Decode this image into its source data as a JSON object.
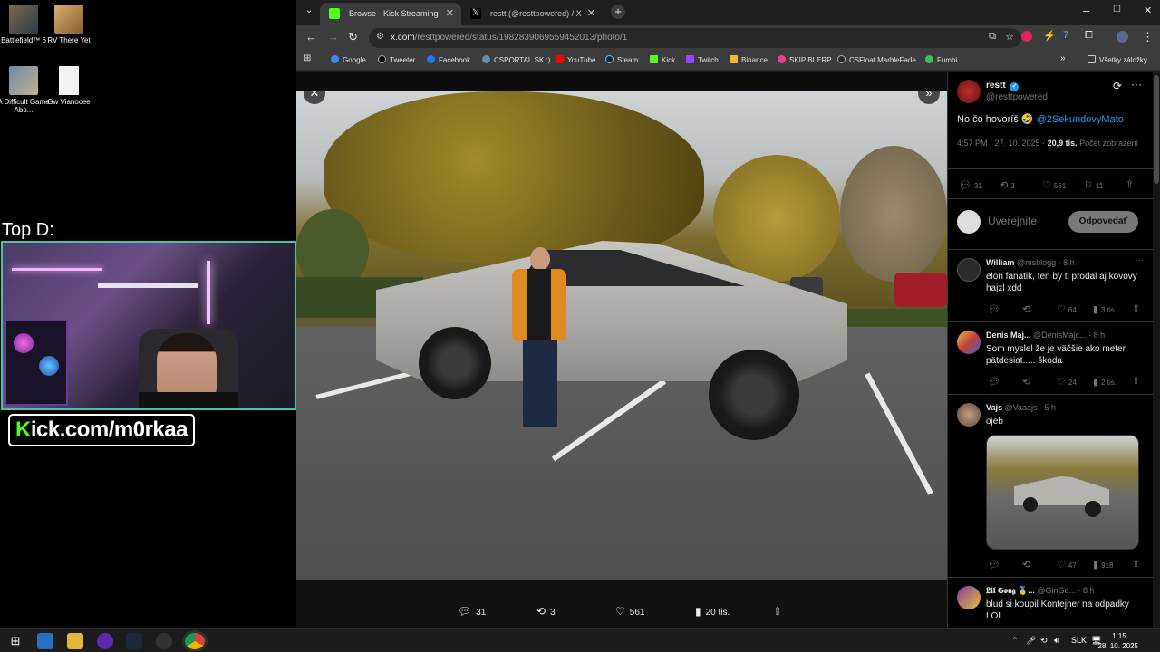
{
  "desktop": {
    "icons": [
      {
        "label": "Battlefield™ 6"
      },
      {
        "label": "RV There Yet"
      },
      {
        "label": "A Difficult Game Abo..."
      },
      {
        "label": "Gw Vianocee"
      }
    ],
    "overlay_title": "Top D:",
    "stream_url_k": "K",
    "stream_url_rest": "ick.com/m0rkaa"
  },
  "browser": {
    "tabs": [
      {
        "title": "Browse - Kick Streaming",
        "active": true
      },
      {
        "title": "restt (@resttpowered) / X",
        "active": false
      }
    ],
    "url_host": "x.com",
    "url_path": "/resttpowered/status/1982839069559452013/photo/1",
    "bookmarks": [
      "Google",
      "Tweeter",
      "Facebook",
      "CSPORTAL.SK :)",
      "YouTube",
      "Steam",
      "Kick",
      "Twitch",
      "Binance",
      "SKIP BLERP",
      "CSFloat MarbleFade",
      "Fumbi"
    ],
    "all_bookmarks": "Všetky záložky"
  },
  "photo_actions": {
    "replies": "31",
    "reposts": "3",
    "likes": "561",
    "views": "20 tis."
  },
  "tweet": {
    "author_name": "restt",
    "author_handle": "@resttpowered",
    "text_prefix": "No čo hovoríš 🤣 ",
    "text_mention": "@2SekundovyMato",
    "time": "4:57 PM · 27. 10. 2025 · ",
    "views_count": "20,9 tis.",
    "views_label": "Počet zobrazení",
    "replies": "31",
    "reposts": "3",
    "likes": "561",
    "bookmarks": "11",
    "compose_placeholder": "Uverejnite",
    "reply_button": "Odpovedať"
  },
  "replies": [
    {
      "name": "William",
      "handle": "@msblogg · 8 h",
      "text": "elon fanatik, ten by ti prodal aj kovovy hajzl xdd",
      "likes": "64",
      "views": "3 tis."
    },
    {
      "name": "Denis Maj...",
      "handle": "@DenisMajc... · 8 h",
      "text": "Som myslel že je väčšie ako meter pätdesiat..... škoda",
      "likes": "24",
      "views": "2 tis."
    },
    {
      "name": "Vajs",
      "handle": "@Vaaajs · 5 h",
      "text": "ojeb",
      "likes": "47",
      "views": "918"
    },
    {
      "name": "𝕷𝖎𝖑 𝕲𝖔𝖓𝖌 🥇...",
      "handle": "@GinGo... · 8 h",
      "text": "blud si koupil Kontejner na odpadky LOL"
    }
  ],
  "taskbar": {
    "lang": "SLK",
    "time": "1:15",
    "date": "28. 10. 2025"
  },
  "colors": {
    "kick_green": "#53fc18",
    "x_blue": "#1d9bf0",
    "webcam_border": "#3cc7a8"
  }
}
